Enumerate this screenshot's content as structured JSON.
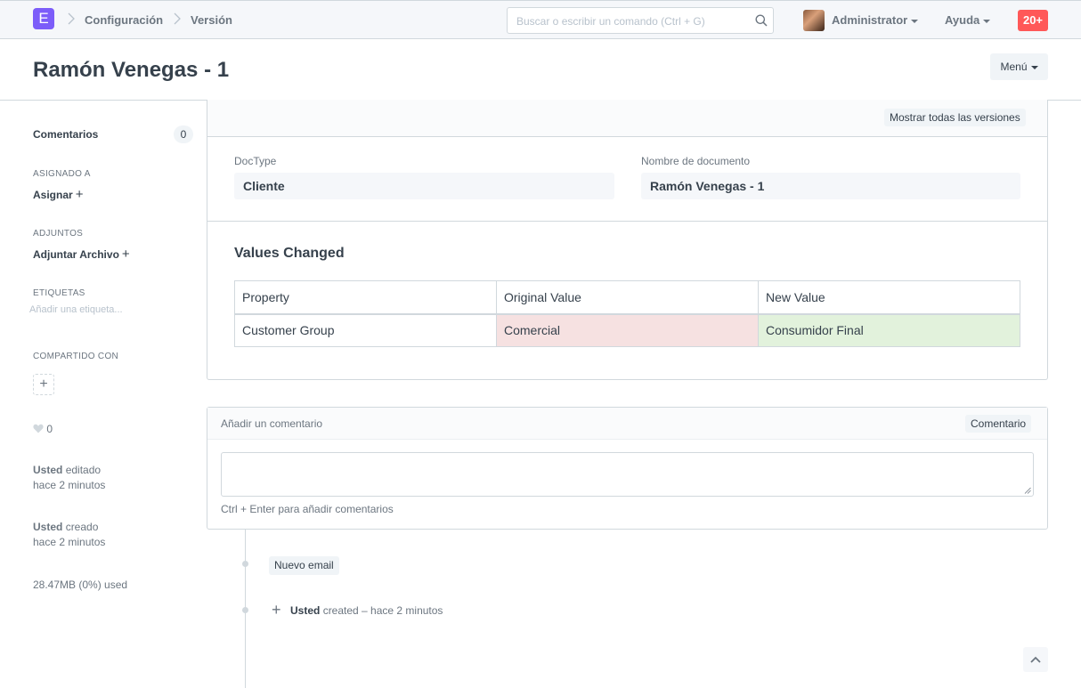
{
  "navbar": {
    "logo_letter": "E",
    "breadcrumbs": [
      "Configuración",
      "Versión"
    ],
    "search_placeholder": "Buscar o escribir un comando (Ctrl + G)",
    "user_label": "Administrator",
    "help_label": "Ayuda",
    "notification_count": "20+"
  },
  "page": {
    "title": "Ramón Venegas - 1",
    "menu_label": "Menú"
  },
  "sidebar": {
    "comments_label": "Comentarios",
    "comments_count": "0",
    "assigned_heading": "ASIGNADO A",
    "assign_label": "Asignar",
    "attachments_heading": "ADJUNTOS",
    "attach_label": "Adjuntar Archivo",
    "tags_heading": "ETIQUETAS",
    "tags_placeholder": "Añadir una etiqueta...",
    "shared_heading": "COMPARTIDO CON",
    "likes_count": "0",
    "edited_by": "Usted",
    "edited_action": "editado",
    "edited_time": "hace 2 minutos",
    "created_by": "Usted",
    "created_action": "creado",
    "created_time": "hace 2 minutos",
    "storage_used": "28.47MB (0%) used"
  },
  "form": {
    "show_all_versions_label": "Mostrar todas las versiones",
    "doctype_label": "DocType",
    "doctype_value": "Cliente",
    "docname_label": "Nombre de documento",
    "docname_value": "Ramón Venegas - 1",
    "section_title": "Values Changed",
    "table_headers": [
      "Property",
      "Original Value",
      "New Value"
    ],
    "table_rows": [
      {
        "property": "Customer Group",
        "original": "Comercial",
        "new": "Consumidor Final"
      }
    ]
  },
  "comment": {
    "header_label": "Añadir un comentario",
    "button_label": "Comentario",
    "hint": "Ctrl + Enter para añadir comentarios"
  },
  "timeline": {
    "email_button_label": "Nuevo email",
    "entry_user": "Usted",
    "entry_text": "created – hace 2 minutos"
  },
  "colors": {
    "accent": "#7c5df9",
    "notification": "#ff5858",
    "old_value_bg": "#f6e1e1",
    "new_value_bg": "#e2f2dc"
  }
}
